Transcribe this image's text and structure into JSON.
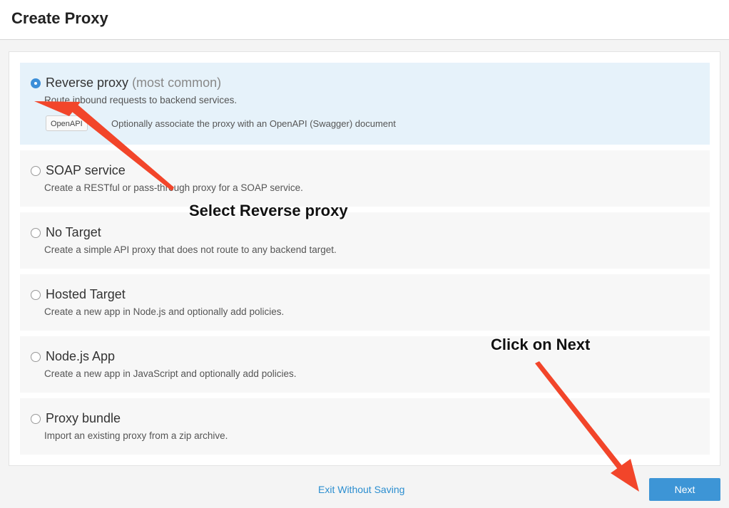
{
  "header": {
    "title": "Create Proxy"
  },
  "options": [
    {
      "title": "Reverse proxy",
      "note": "(most common)",
      "description": "Route inbound requests to backend services.",
      "selected": true
    },
    {
      "title": "SOAP service",
      "description": "Create a RESTful or pass-through proxy for a SOAP service.",
      "selected": false
    },
    {
      "title": "No Target",
      "description": "Create a simple API proxy that does not route to any backend target.",
      "selected": false
    },
    {
      "title": "Hosted Target",
      "description": "Create a new app in Node.js and optionally add policies.",
      "selected": false
    },
    {
      "title": "Node.js App",
      "description": "Create a new app in JavaScript and optionally add policies.",
      "selected": false
    },
    {
      "title": "Proxy bundle",
      "description": "Import an existing proxy from a zip archive.",
      "selected": false
    }
  ],
  "openapi": {
    "button_label": "OpenAPI",
    "text": "Optionally associate the proxy with an OpenAPI (Swagger) document"
  },
  "footer": {
    "exit_label": "Exit Without Saving",
    "next_label": "Next"
  },
  "annotations": {
    "select_reverse": "Select Reverse proxy",
    "click_next": "Click on Next"
  },
  "colors": {
    "accent": "#3d95d6",
    "selected_bg": "#e6f2fa",
    "arrow": "#f2452a"
  }
}
